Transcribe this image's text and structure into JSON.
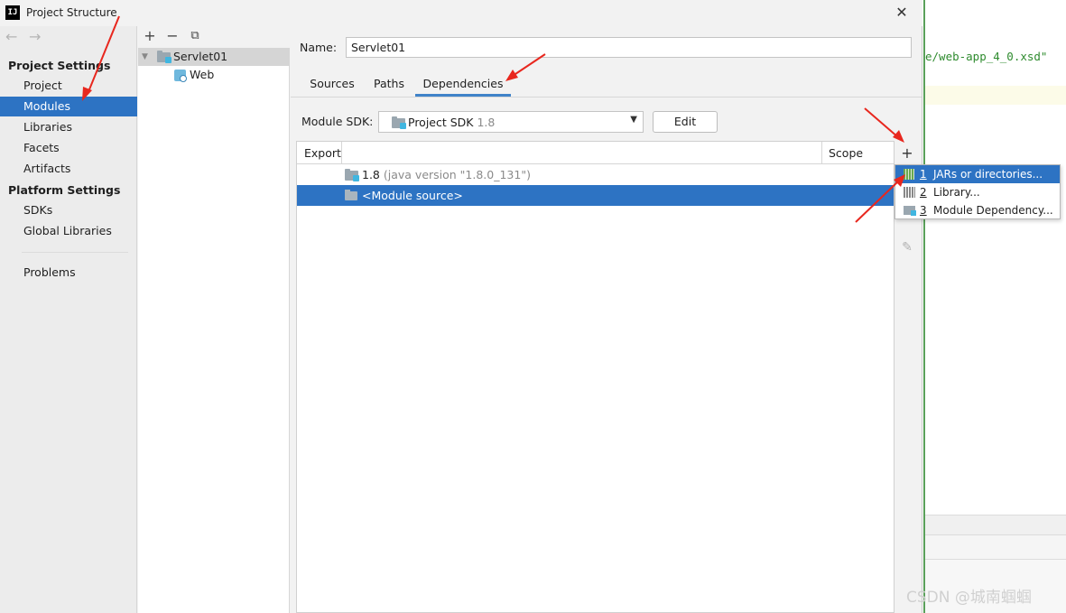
{
  "window": {
    "title": "Project Structure",
    "app_icon": "IJ"
  },
  "nav": {
    "back": "←",
    "forward": "→",
    "project_settings_header": "Project Settings",
    "project_settings": [
      "Project",
      "Modules",
      "Libraries",
      "Facets",
      "Artifacts"
    ],
    "platform_settings_header": "Platform Settings",
    "platform_settings": [
      "SDKs",
      "Global Libraries"
    ],
    "problems": "Problems",
    "selected": "Modules"
  },
  "tree": {
    "toolbar": [
      "+",
      "−",
      "⧉"
    ],
    "nodes": [
      {
        "label": "Servlet01",
        "icon": "module-folder-icon"
      },
      {
        "label": "Web",
        "icon": "web-facet-icon"
      }
    ]
  },
  "module": {
    "name_label": "Name:",
    "name_value": "Servlet01",
    "tabs": [
      "Sources",
      "Paths",
      "Dependencies"
    ],
    "active_tab": "Dependencies",
    "sdk_label": "Module SDK:",
    "sdk_value": "Project SDK",
    "sdk_version": "1.8",
    "edit_label": "Edit"
  },
  "dependencies": {
    "headers": [
      "Export",
      "Scope"
    ],
    "rows": [
      {
        "name": "1.8",
        "detail": "(java version \"1.8.0_131\")"
      },
      {
        "name": "<Module source>",
        "detail": ""
      }
    ],
    "side_toolbar": [
      "+",
      "✎"
    ]
  },
  "popup": {
    "items": [
      {
        "num": "1",
        "label": "JARs or directories...",
        "icon": "jar-icon"
      },
      {
        "num": "2",
        "label": "Library...",
        "icon": "library-icon"
      },
      {
        "num": "3",
        "label": "Module Dependency...",
        "icon": "module-dependency-icon"
      }
    ]
  },
  "editor": {
    "code": "e/web-app_4_0.xsd\""
  },
  "watermark": "CSDN @城南蝈蝈",
  "colors": {
    "selection": "#2d73c3",
    "arrow": "#e8271e",
    "code": "#2e8b2e"
  }
}
